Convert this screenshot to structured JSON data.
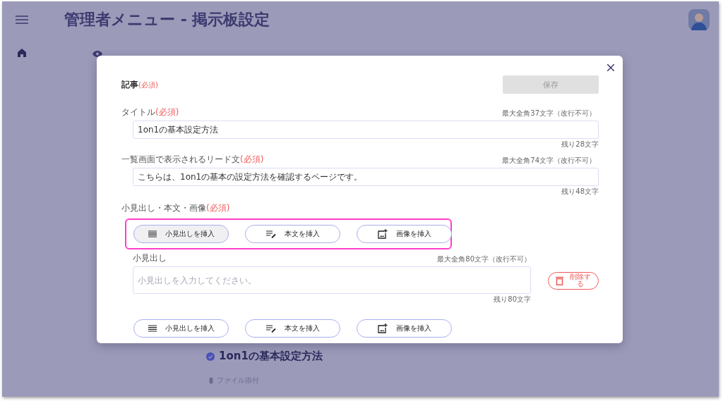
{
  "page": {
    "title": "管理者メニュー - 掲示板設定",
    "article_title": "1on1の基本設定方法",
    "attachment_label": "ファイル添付"
  },
  "dialog": {
    "heading": "記事",
    "heading_required": "(必須)",
    "save_button": {
      "label": "保存",
      "disabled": true
    },
    "fields": [
      {
        "label": "タイトル",
        "required": "(必須)",
        "limit": "最大全角37文字（改行不可）",
        "value": "1on1の基本設定方法",
        "remaining": "残り28文字"
      },
      {
        "label": "一覧画面で表示されるリード文",
        "required": "(必須)",
        "limit": "最大全角74文字（改行不可）",
        "value": "こちらは、1on1の基本の設定方法を確認するページです。",
        "remaining": "残り48文字"
      }
    ],
    "content_label": "小見出し・本文・画像",
    "content_required": "(必須)",
    "content": [
      {
        "kind": "insert_row",
        "highlighted": true,
        "buttons": [
          {
            "kind": "heading",
            "label": "小見出しを挿入",
            "selected": true
          },
          {
            "kind": "text",
            "label": "本文を挿入",
            "selected": false
          },
          {
            "kind": "image",
            "label": "画像を挿入",
            "selected": false
          }
        ]
      },
      {
        "kind": "heading_block",
        "label": "小見出し",
        "limit": "最大全角80文字（改行不可）",
        "placeholder": "小見出しを入力してください。",
        "remaining": "残り80文字",
        "delete_label": "削除する"
      },
      {
        "kind": "insert_row",
        "highlighted": false,
        "buttons": [
          {
            "kind": "heading",
            "label": "小見出しを挿入",
            "selected": false
          },
          {
            "kind": "text",
            "label": "本文を挿入",
            "selected": false
          },
          {
            "kind": "image",
            "label": "画像を挿入",
            "selected": false
          }
        ]
      }
    ]
  }
}
